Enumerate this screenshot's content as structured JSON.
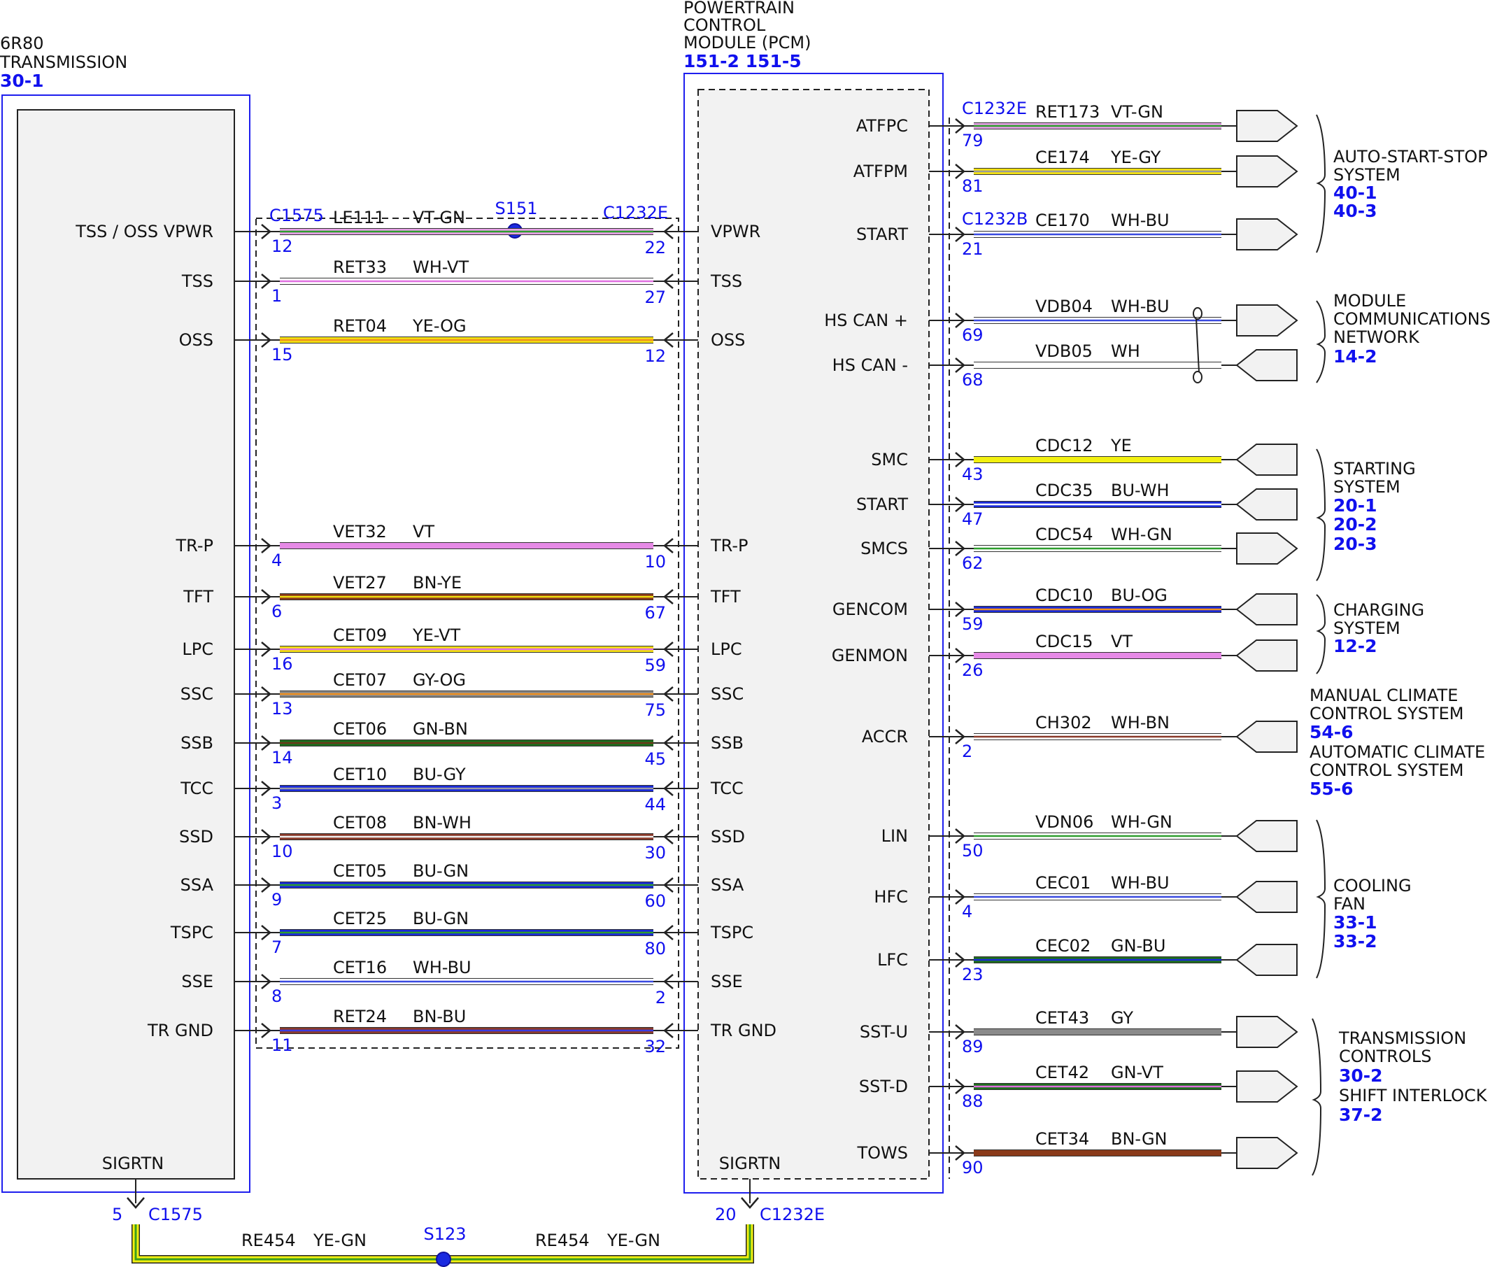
{
  "modules": {
    "transmission": {
      "name": [
        "6R80",
        "TRANSMISSION"
      ],
      "ref": "30-1"
    },
    "pcm": {
      "name": [
        "POWERTRAIN",
        "CONTROL",
        "MODULE (PCM)"
      ],
      "ref": "151-2 151-5"
    }
  },
  "splices": {
    "s151": "S151",
    "s123": "S123"
  },
  "connectors": {
    "c1575": "C1575",
    "c1232e": "C1232E",
    "c1232b": "C1232B"
  },
  "trans_pcm_circuits": [
    {
      "tlabel": "TSS / OSS VPWR",
      "plabel": "VPWR",
      "circuit": "LE111",
      "color_code": "VT-GN",
      "tpin": "12",
      "ppin": "22",
      "c1": "#e6a0e6",
      "c2": "#2e9e2e"
    },
    {
      "tlabel": "TSS",
      "plabel": "TSS",
      "circuit": "RET33",
      "color_code": "WH-VT",
      "tpin": "1",
      "ppin": "27",
      "c1": "#ffffff",
      "c2": "#e070e0"
    },
    {
      "tlabel": "OSS",
      "plabel": "OSS",
      "circuit": "RET04",
      "color_code": "YE-OG",
      "tpin": "15",
      "ppin": "12",
      "c1": "#f2e010",
      "c2": "#f09020"
    },
    {
      "tlabel": "TR-P",
      "plabel": "TR-P",
      "circuit": "VET32",
      "color_code": "VT",
      "tpin": "4",
      "ppin": "10",
      "c1": "#e68ae6",
      "c2": "#e68ae6"
    },
    {
      "tlabel": "TFT",
      "plabel": "TFT",
      "circuit": "VET27",
      "color_code": "BN-YE",
      "tpin": "6",
      "ppin": "67",
      "c1": "#8a3a1a",
      "c2": "#f2e010"
    },
    {
      "tlabel": "LPC",
      "plabel": "LPC",
      "circuit": "CET09",
      "color_code": "YE-VT",
      "tpin": "16",
      "ppin": "59",
      "c1": "#f2e010",
      "c2": "#e070e0"
    },
    {
      "tlabel": "SSC",
      "plabel": "SSC",
      "circuit": "CET07",
      "color_code": "GY-OG",
      "tpin": "13",
      "ppin": "75",
      "c1": "#8a8a8a",
      "c2": "#f09020"
    },
    {
      "tlabel": "SSB",
      "plabel": "SSB",
      "circuit": "CET06",
      "color_code": "GN-BN",
      "tpin": "14",
      "ppin": "45",
      "c1": "#1e6e1e",
      "c2": "#6b3a1a"
    },
    {
      "tlabel": "TCC",
      "plabel": "TCC",
      "circuit": "CET10",
      "color_code": "BU-GY",
      "tpin": "3",
      "ppin": "44",
      "c1": "#1a2ad8",
      "c2": "#9a9aa8"
    },
    {
      "tlabel": "SSD",
      "plabel": "SSD",
      "circuit": "CET08",
      "color_code": "BN-WH",
      "tpin": "10",
      "ppin": "30",
      "c1": "#8a3a2a",
      "c2": "#f0f0f0"
    },
    {
      "tlabel": "SSA",
      "plabel": "SSA",
      "circuit": "CET05",
      "color_code": "BU-GN",
      "tpin": "9",
      "ppin": "60",
      "c1": "#1a2ad8",
      "c2": "#2e9e2e"
    },
    {
      "tlabel": "TSPC",
      "plabel": "TSPC",
      "circuit": "CET25",
      "color_code": "BU-GN",
      "tpin": "7",
      "ppin": "80",
      "c1": "#1a2ad8",
      "c2": "#2e9e2e"
    },
    {
      "tlabel": "SSE",
      "plabel": "SSE",
      "circuit": "CET16",
      "color_code": "WH-BU",
      "tpin": "8",
      "ppin": "2",
      "c1": "#ffffff",
      "c2": "#3a4ae0"
    },
    {
      "tlabel": "TR GND",
      "plabel": "TR GND",
      "circuit": "RET24",
      "color_code": "BN-BU",
      "tpin": "11",
      "ppin": "32",
      "c1": "#8a3a2a",
      "c2": "#3a3ae0"
    }
  ],
  "pcm_right_circuits": [
    {
      "label": "ATFPC",
      "circuit": "RET173",
      "color_code": "VT-GN",
      "pin": "79",
      "c1": "#e6a0e6",
      "c2": "#2e9e2e"
    },
    {
      "label": "ATFPM",
      "circuit": "CE174",
      "color_code": "YE-GY",
      "pin": "81",
      "c1": "#f2e010",
      "c2": "#9a9a9a"
    },
    {
      "label": "START",
      "circuit": "CE170",
      "color_code": "WH-BU",
      "pin": "21",
      "c1": "#ffffff",
      "c2": "#3a4ae0"
    },
    {
      "label": "HS CAN +",
      "circuit": "VDB04",
      "color_code": "WH-BU",
      "pin": "69",
      "c1": "#ffffff",
      "c2": "#3a4ae0"
    },
    {
      "label": "HS CAN -",
      "circuit": "VDB05",
      "color_code": "WH",
      "pin": "68",
      "c1": "#ffffff",
      "c2": "#ffffff"
    },
    {
      "label": "SMC",
      "circuit": "CDC12",
      "color_code": "YE",
      "pin": "43",
      "c1": "#f2f010",
      "c2": "#f2f010"
    },
    {
      "label": "START",
      "circuit": "CDC35",
      "color_code": "BU-WH",
      "pin": "47",
      "c1": "#1a2ad8",
      "c2": "#ffffff"
    },
    {
      "label": "SMCS",
      "circuit": "CDC54",
      "color_code": "WH-GN",
      "pin": "62",
      "c1": "#ffffff",
      "c2": "#2e9e2e"
    },
    {
      "label": "GENCOM",
      "circuit": "CDC10",
      "color_code": "BU-OG",
      "pin": "59",
      "c1": "#1a2ad8",
      "c2": "#f09020"
    },
    {
      "label": "GENMON",
      "circuit": "CDC15",
      "color_code": "VT",
      "pin": "26",
      "c1": "#e68ae6",
      "c2": "#e68ae6"
    },
    {
      "label": "ACCR",
      "circuit": "CH302",
      "color_code": "WH-BN",
      "pin": "2",
      "c1": "#ffffff",
      "c2": "#8a3a2a"
    },
    {
      "label": "LIN",
      "circuit": "VDN06",
      "color_code": "WH-GN",
      "pin": "50",
      "c1": "#ffffff",
      "c2": "#2e9e2e"
    },
    {
      "label": "HFC",
      "circuit": "CEC01",
      "color_code": "WH-BU",
      "pin": "4",
      "c1": "#ffffff",
      "c2": "#3a4ae0"
    },
    {
      "label": "LFC",
      "circuit": "CEC02",
      "color_code": "GN-BU",
      "pin": "23",
      "c1": "#1e6e1e",
      "c2": "#1a2ad8"
    },
    {
      "label": "SST-U",
      "circuit": "CET43",
      "color_code": "GY",
      "pin": "89",
      "c1": "#8a8a8a",
      "c2": "#8a8a8a"
    },
    {
      "label": "SST-D",
      "circuit": "CET42",
      "color_code": "GN-VT",
      "pin": "88",
      "c1": "#1e6e1e",
      "c2": "#e070e0"
    },
    {
      "label": "TOWS",
      "circuit": "CET34",
      "color_code": "BN-GN",
      "pin": "90",
      "c1": "#8a3a1a",
      "c2": "#8a3a1a"
    }
  ],
  "systems": [
    {
      "lines": [
        "AUTO-START-STOP",
        "SYSTEM"
      ],
      "refs": [
        "40-1",
        "40-3"
      ]
    },
    {
      "lines": [
        "MODULE",
        "COMMUNICATIONS",
        "NETWORK"
      ],
      "refs": [
        "14-2"
      ]
    },
    {
      "lines": [
        "STARTING",
        "SYSTEM"
      ],
      "refs": [
        "20-1",
        "20-2",
        "20-3"
      ]
    },
    {
      "lines": [
        "CHARGING",
        "SYSTEM"
      ],
      "refs": [
        "12-2"
      ]
    },
    {
      "lines": [
        "MANUAL CLIMATE",
        "CONTROL SYSTEM"
      ],
      "refs": [
        "54-6"
      ]
    },
    {
      "lines": [
        "AUTOMATIC CLIMATE",
        "CONTROL SYSTEM"
      ],
      "refs": [
        "55-6"
      ]
    },
    {
      "lines": [
        "COOLING",
        "FAN"
      ],
      "refs": [
        "33-1",
        "33-2"
      ]
    },
    {
      "lines": [
        "TRANSMISSION",
        "CONTROLS"
      ],
      "refs": [
        "30-2"
      ]
    },
    {
      "lines": [
        "SHIFT INTERLOCK"
      ],
      "refs": [
        "37-2"
      ]
    }
  ],
  "ground": {
    "tlabel": "SIGRTN",
    "plabel": "SIGRTN",
    "tpin": "5",
    "ppin": "20",
    "circuit": "RE454",
    "color_code": "YE-GN",
    "c1": "#f2f010",
    "c2": "#3a9e1e"
  }
}
